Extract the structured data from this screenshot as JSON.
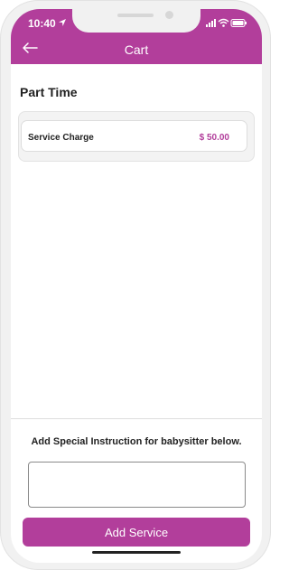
{
  "status_bar": {
    "time": "10:40"
  },
  "header": {
    "title": "Cart",
    "back_icon": "arrow-left-icon"
  },
  "cart": {
    "section_title": "Part Time",
    "items": [
      {
        "label": "Service Charge",
        "value": "$ 50.00"
      }
    ]
  },
  "instructions": {
    "label": "Add Special Instruction for babysitter below.",
    "value": ""
  },
  "actions": {
    "add_service_label": "Add Service"
  },
  "colors": {
    "accent": "#b23e9b"
  }
}
